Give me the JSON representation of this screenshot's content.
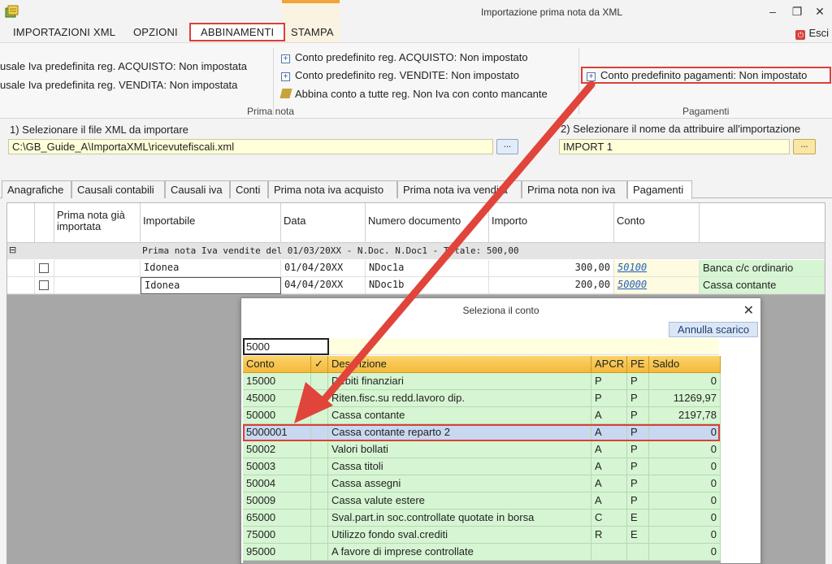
{
  "window": {
    "title": "Importazione prima nota da XML",
    "minimize": "–",
    "restore": "❐",
    "close": "✕"
  },
  "menu": {
    "items": [
      "IMPORTAZIONI XML",
      "OPZIONI",
      "ABBINAMENTI",
      "STAMPA"
    ],
    "active": "ABBINAMENTI",
    "exit_label": "Esci"
  },
  "ribbon": {
    "causale_acquisto": "usale Iva predefinita reg. ACQUISTO: Non impostata",
    "causale_vendita": "usale Iva predefinita reg. VENDITA: Non impostata",
    "conto_acquisto": "Conto predefinito reg. ACQUISTO: Non impostato",
    "conto_vendite": "Conto predefinito reg. VENDITE: Non impostato",
    "abbina_conto": "Abbina conto a tutte reg. Non Iva con conto mancante",
    "conto_pagamenti": "Conto predefinito pagamenti: Non impostato",
    "group_prima_nota": "Prima nota",
    "group_pagamenti": "Pagamenti"
  },
  "file_select": {
    "label": "1) Selezionare il file XML da importare",
    "value": "C:\\GB_Guide_A\\ImportaXML\\ricevutefiscali.xml",
    "browse": "..."
  },
  "import_name": {
    "label": "2) Selezionare il nome da attribuire all'importazione",
    "value": "IMPORT 1",
    "browse": "..."
  },
  "tabs": [
    "Anagrafiche",
    "Causali contabili",
    "Causali iva",
    "Conti",
    "Prima nota iva acquisto",
    "Prima nota iva vendita",
    "Prima nota non iva",
    "Pagamenti"
  ],
  "active_tab": "Pagamenti",
  "grid": {
    "headers": [
      "Prima nota già importata",
      "Importabile",
      "Data",
      "Numero documento",
      "Importo",
      "Conto"
    ],
    "group_toggle": "⊟",
    "group_label": "Prima nota Iva vendite del 01/03/20XX - N.Doc. N.Doc1 - Totale: 500,00",
    "rows": [
      {
        "importabile": "Idonea",
        "data": "01/04/20XX",
        "numero": "NDoc1a",
        "importo": "300,00",
        "conto": "50100",
        "descrizione": "Banca c/c ordinario"
      },
      {
        "importabile": "Idonea",
        "data": "04/04/20XX",
        "numero": "NDoc1b",
        "importo": "200,00",
        "conto": "50000",
        "descrizione": "Cassa contante"
      }
    ]
  },
  "dialog": {
    "title": "Seleziona il conto",
    "close": "✕",
    "annulla": "Annulla scarico",
    "search_value": "5000",
    "headers": [
      "Conto",
      "✓",
      "Descrizione",
      "APCR",
      "PE",
      "Saldo"
    ],
    "rows": [
      {
        "conto": "15000",
        "descrizione": "Debiti finanziari",
        "apcr": "P",
        "pe": "P",
        "saldo": "0"
      },
      {
        "conto": "45000",
        "descrizione": "Riten.fisc.su redd.lavoro dip.",
        "apcr": "P",
        "pe": "P",
        "saldo": "11269,97"
      },
      {
        "conto": "50000",
        "descrizione": "Cassa contante",
        "apcr": "A",
        "pe": "P",
        "saldo": "2197,78"
      },
      {
        "conto": "5000001",
        "descrizione": "Cassa contante reparto 2",
        "apcr": "A",
        "pe": "P",
        "saldo": "0"
      },
      {
        "conto": "50002",
        "descrizione": "Valori bollati",
        "apcr": "A",
        "pe": "P",
        "saldo": "0"
      },
      {
        "conto": "50003",
        "descrizione": "Cassa titoli",
        "apcr": "A",
        "pe": "P",
        "saldo": "0"
      },
      {
        "conto": "50004",
        "descrizione": "Cassa assegni",
        "apcr": "A",
        "pe": "P",
        "saldo": "0"
      },
      {
        "conto": "50009",
        "descrizione": "Cassa valute estere",
        "apcr": "A",
        "pe": "P",
        "saldo": "0"
      },
      {
        "conto": "65000",
        "descrizione": "Sval.part.in soc.controllate quotate in borsa",
        "apcr": "C",
        "pe": "E",
        "saldo": "0"
      },
      {
        "conto": "75000",
        "descrizione": "Utilizzo fondo sval.crediti",
        "apcr": "R",
        "pe": "E",
        "saldo": "0"
      },
      {
        "conto": "95000",
        "descrizione": "A favore di imprese controllate",
        "apcr": "",
        "pe": "",
        "saldo": "0"
      }
    ],
    "selected_index": 3
  },
  "colors": {
    "highlight_red": "#d9403a",
    "row_green": "#d6f5d2",
    "header_orange": "#f4b93a",
    "input_yellow": "#ffffd9"
  }
}
